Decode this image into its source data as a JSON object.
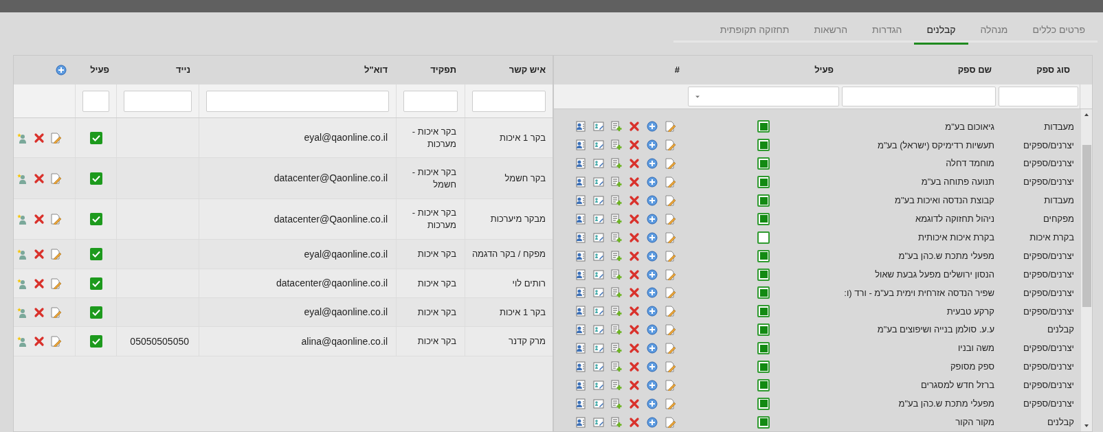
{
  "tabs": [
    {
      "label": "פרטים כללים",
      "selected": false
    },
    {
      "label": "מנהלה",
      "selected": false
    },
    {
      "label": "קבלנים",
      "selected": true
    },
    {
      "label": "הגדרות",
      "selected": false
    },
    {
      "label": "הרשאות",
      "selected": false
    },
    {
      "label": "תחזוקה תקופתית",
      "selected": false
    }
  ],
  "suppliers": {
    "columns": [
      "סוג ספק",
      "שם ספק",
      "פעיל",
      "#"
    ],
    "rows": [
      {
        "type": "מעבדות",
        "name": "גיאוכום בע\"מ",
        "active": true
      },
      {
        "type": "יצרנים/ספקים",
        "name": "תעשיות רדימיקס (ישראל) בע\"מ",
        "active": true
      },
      {
        "type": "יצרנים/ספקים",
        "name": "מוחמד דחלה",
        "active": true
      },
      {
        "type": "יצרנים/ספקים",
        "name": "תנועה פתוחה בע\"מ",
        "active": true
      },
      {
        "type": "מעבדות",
        "name": "קבוצת הנדסה ואיכות בע\"מ",
        "active": true
      },
      {
        "type": "מפקחים",
        "name": "ניהול תחזוקה לדוגמא",
        "active": true
      },
      {
        "type": "בקרת איכות",
        "name": "בקרת איכות איכותית",
        "active": false
      },
      {
        "type": "יצרנים/ספקים",
        "name": "מפעלי מתכת ש.כהן בע\"מ",
        "active": true
      },
      {
        "type": "יצרנים/ספקים",
        "name": "הנסון ירושלים מפעל גבעת שאול",
        "active": true
      },
      {
        "type": "יצרנים/ספקים",
        "name": "שפיר הנדסה אזרחית וימית בע\"מ - ורד (ו:",
        "active": true
      },
      {
        "type": "יצרנים/ספקים",
        "name": "קרקע טבעית",
        "active": true
      },
      {
        "type": "קבלנים",
        "name": "ע.ע. סולמן בנייה ושיפוצים בע\"מ",
        "active": true
      },
      {
        "type": "יצרנים/ספקים",
        "name": "משה ובניו",
        "active": true
      },
      {
        "type": "יצרנים/ספקים",
        "name": "ספק מסופק",
        "active": true
      },
      {
        "type": "יצרנים/ספקים",
        "name": "ברזל חדש למסגרים",
        "active": true
      },
      {
        "type": "יצרנים/ספקים",
        "name": "מפעלי מתכת ש.כהן בע\"מ",
        "active": true
      },
      {
        "type": "קבלנים",
        "name": "מקור הקור",
        "active": true
      }
    ]
  },
  "contacts": {
    "columns": [
      "איש קשר",
      "תפקיד",
      "דוא\"ל",
      "נייד",
      "פעיל"
    ],
    "rows": [
      {
        "contact": "בקר 1 איכות",
        "role": "בקר איכות - מערכות",
        "email": "eyal@qaonline.co.il",
        "mobile": "",
        "active": true
      },
      {
        "contact": "בקר חשמל",
        "role": "בקר איכות - חשמל",
        "email": "datacenter@Qaonline.co.il",
        "mobile": "",
        "active": true
      },
      {
        "contact": "מבקר מיערכות",
        "role": "בקר איכות - מערכות",
        "email": "datacenter@Qaonline.co.il",
        "mobile": "",
        "active": true
      },
      {
        "contact": "מפקח / בקר הדגמה",
        "role": "בקר איכות",
        "email": "eyal@qaonline.co.il",
        "mobile": "",
        "active": true
      },
      {
        "contact": "רותים לוי",
        "role": "בקר איכות",
        "email": "datacenter@qaonline.co.il",
        "mobile": "",
        "active": true
      },
      {
        "contact": "בקר 1 איכות",
        "role": "בקר איכות",
        "email": "eyal@qaonline.co.il",
        "mobile": "",
        "active": true
      },
      {
        "contact": "מרק קדנר",
        "role": "בקר איכות",
        "email": "alina@qaonline.co.il",
        "mobile": "05050505050",
        "active": true
      }
    ]
  }
}
